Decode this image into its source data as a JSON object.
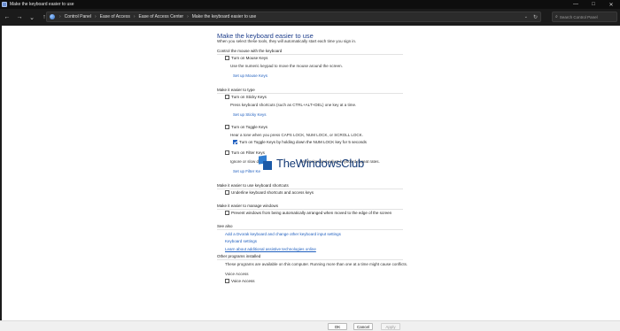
{
  "window": {
    "title": "Make the keyboard easier to use",
    "controls": {
      "minimize": "—",
      "maximize": "□",
      "close": "✕"
    }
  },
  "nav": {
    "back": "←",
    "forward": "→",
    "recent": "⌄",
    "up": "↑",
    "breadcrumb": [
      "Control Panel",
      "Ease of Access",
      "Ease of Access Center",
      "Make the keyboard easier to use"
    ],
    "separator": "›",
    "dropdown": "⌄",
    "refresh": "↻",
    "search_placeholder": "Search Control Panel",
    "search_icon": "⌕"
  },
  "page": {
    "title": "Make the keyboard easier to use",
    "intro": "When you select these tools, they will automatically start each time you sign in."
  },
  "sections": {
    "mouse": {
      "title": "Control the mouse with the keyboard",
      "mouse_keys": {
        "label": "Turn on Mouse Keys",
        "checked": false
      },
      "mouse_keys_desc": "Use the numeric keypad to move the mouse around the screen.",
      "mouse_keys_link": "Set up Mouse Keys"
    },
    "typing": {
      "title": "Make it easier to type",
      "sticky_keys": {
        "label": "Turn on Sticky Keys",
        "checked": false
      },
      "sticky_desc": "Press keyboard shortcuts (such as CTRL+ALT+DEL) one key at a time.",
      "sticky_link": "Set up Sticky Keys",
      "toggle_keys": {
        "label": "Turn on Toggle Keys",
        "checked": false
      },
      "toggle_desc": "Hear a tone when you press CAPS LOCK, NUM LOCK, or SCROLL LOCK.",
      "toggle_hold": {
        "label": "Turn on Toggle Keys by holding down the NUM LOCK key for 5 seconds",
        "checked": true
      },
      "filter_keys": {
        "label": "Turn on Filter Keys",
        "checked": false
      },
      "filter_desc_left": "Ignore or slow d",
      "filter_desc_right": "keystrokes and adjust keyboard repeat rates.",
      "filter_link": "Set up Filter Ke"
    },
    "shortcuts": {
      "title": "Make it easier to use keyboard shortcuts",
      "underline": {
        "label": "Underline keyboard shortcuts and access keys",
        "checked": false
      }
    },
    "windows": {
      "title": "Make it easier to manage windows",
      "prevent": {
        "label": "Prevent windows from being automatically arranged when moved to the edge of the screen",
        "checked": false
      }
    },
    "see_also": {
      "title": "See also",
      "links": [
        "Add a Dvorak keyboard and change other keyboard input settings",
        "Keyboard settings",
        "Learn about additional assistive technologies online"
      ]
    },
    "other": {
      "title": "Other programs installed",
      "desc": "These programs are available on this computer. Running more than one at a time might cause conflicts.",
      "program_name": "Voice Access",
      "voice_access": {
        "label": "Voice Access",
        "checked": false
      }
    }
  },
  "watermark": {
    "text": "TheWindowsClub"
  },
  "footer": {
    "ok": "OK",
    "cancel": "Cancel",
    "apply": "Apply"
  }
}
